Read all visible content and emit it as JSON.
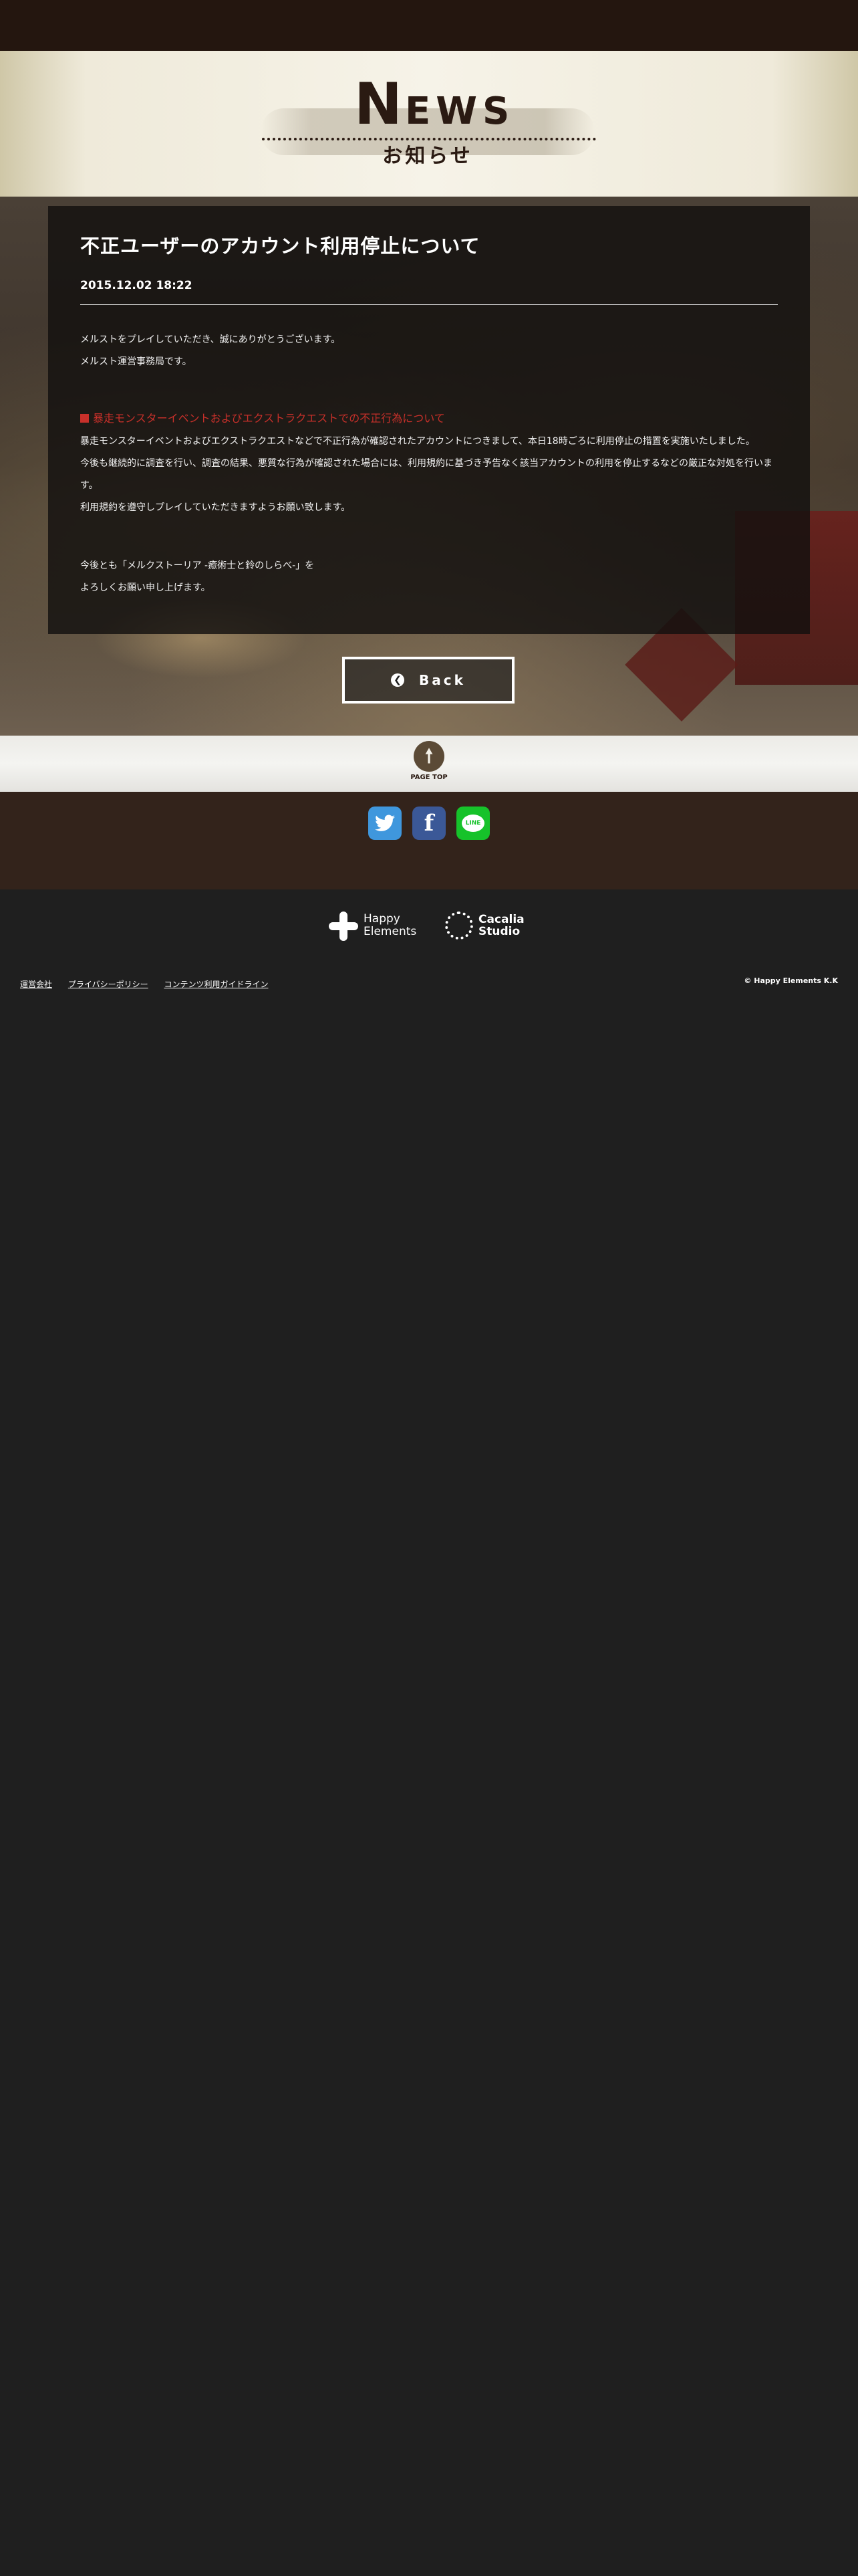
{
  "header": {
    "news_title_first": "N",
    "news_title_rest": "EWS",
    "news_subtitle": "お知らせ"
  },
  "article": {
    "title": "不正ユーザーのアカウント利用停止について",
    "date": "2015.12.02  18:22",
    "intro": [
      "メルストをプレイしていただき、誠にありがとうございます。",
      "メルスト運営事務局です。"
    ],
    "section_heading": "暴走モンスターイベントおよびエクストラクエストでの不正行為について",
    "section_body": [
      "暴走モンスターイベントおよびエクストラクエストなどで不正行為が確認されたアカウントにつきまして、本日18時ごろに利用停止の措置を実施いたしました。",
      "今後も継続的に調査を行い、調査の結果、悪質な行為が確認された場合には、利用規約に基づき予告なく該当アカウントの利用を停止するなどの厳正な対処を行います。",
      "利用規約を遵守しプレイしていただきますようお願い致します。"
    ],
    "closing": [
      "今後とも「メルクストーリア -癒術士と鈴のしらべ-」を",
      "よろしくお願い申し上げます。"
    ]
  },
  "back_button": {
    "label": "Back",
    "icon": "chevron-left-circle-icon"
  },
  "page_top": {
    "label": "PAGE TOP",
    "icon": "arrow-up-icon"
  },
  "social": {
    "twitter_icon": "twitter-icon",
    "facebook_icon": "facebook-icon",
    "line_icon": "line-icon",
    "line_text": "LINE",
    "facebook_glyph": "f"
  },
  "logos": {
    "happy_elements_line1": "Happy",
    "happy_elements_line2": "Elements",
    "cacalia_line1": "Cacalia",
    "cacalia_line2": "Studio"
  },
  "footer": {
    "links": [
      "運営会社",
      "プライバシーポリシー",
      "コンテンツ利用ガイドライン"
    ],
    "copyright": "© Happy Elements K.K"
  },
  "colors": {
    "top_bar": "#24160f",
    "heading_red": "#c8302a",
    "footer_bg": "#1f1f1f",
    "social_band": "#33231b",
    "twitter": "#3f97dd",
    "facebook": "#3b5897",
    "line": "#16c22a"
  }
}
